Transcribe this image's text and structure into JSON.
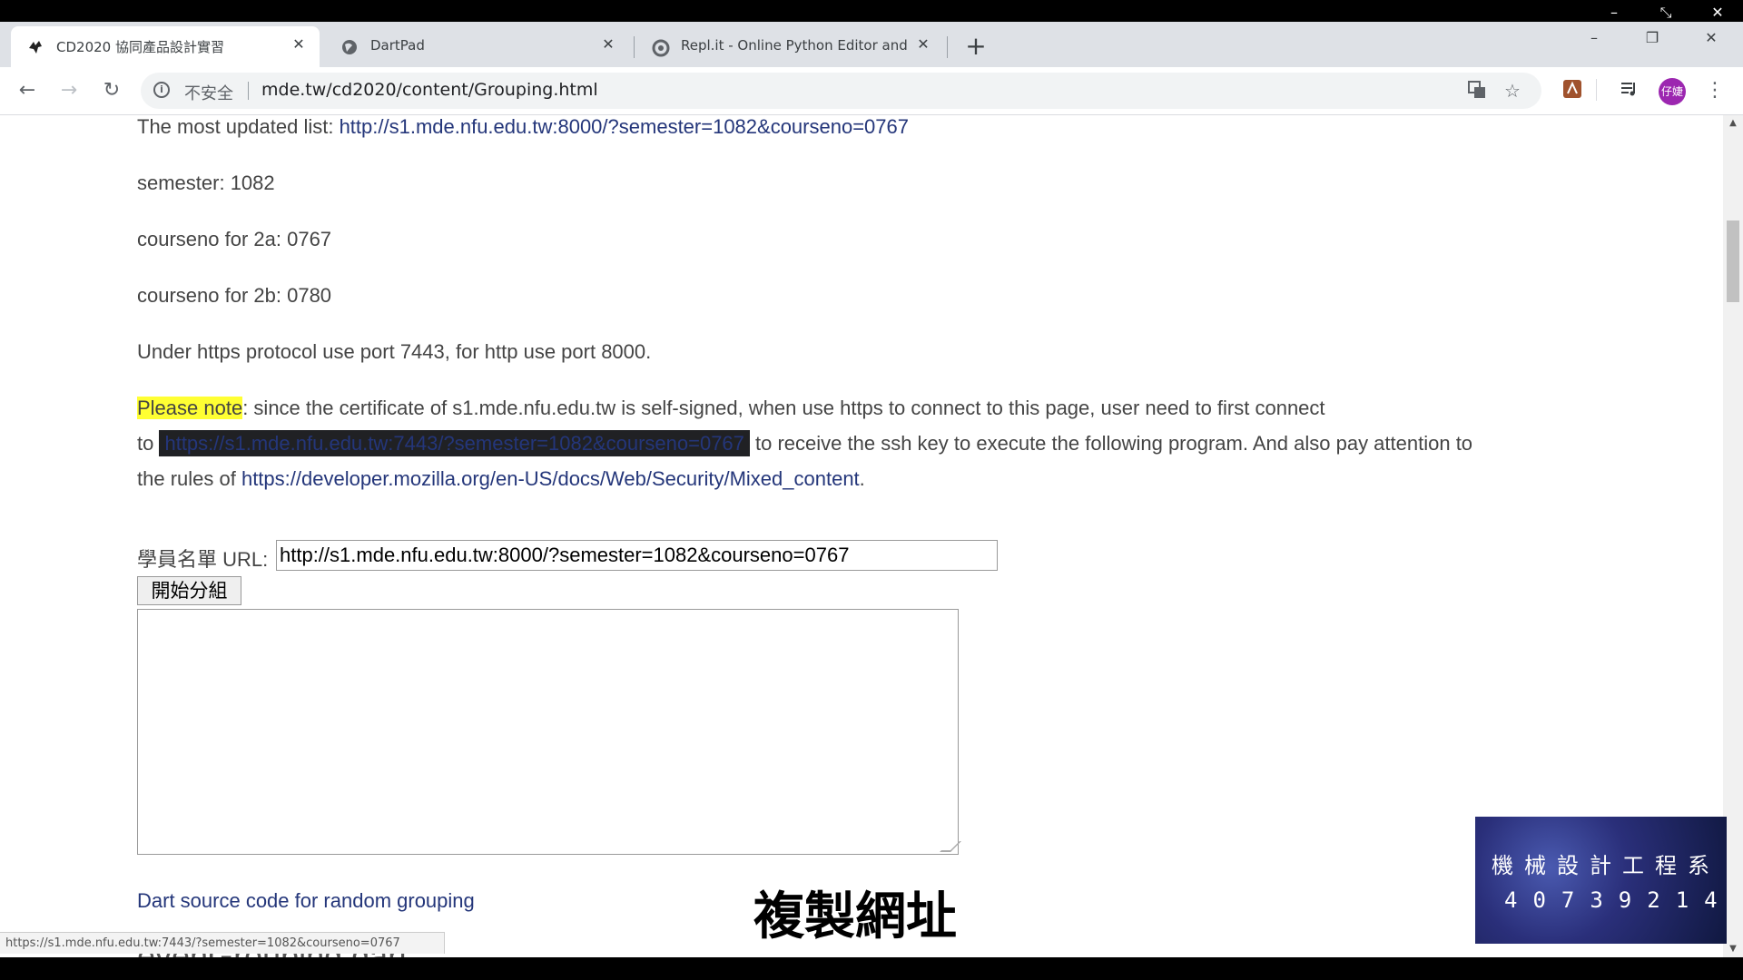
{
  "tabs": [
    {
      "title": "CD2020 協同產品設計實習",
      "close": "✕"
    },
    {
      "title": "DartPad",
      "close": "✕"
    },
    {
      "title": "Repl.it - Online Python Editor and IDE",
      "close": "✕"
    }
  ],
  "new_tab": "+",
  "omnibox": {
    "security_label": "不安全",
    "url": "mde.tw/cd2020/content/Grouping.html"
  },
  "avatar_text": "仔婕",
  "page": {
    "line1_prefix": "The most updated list: ",
    "line1_link": "http://s1.mde.nfu.edu.tw:8000/?semester=1082&courseno=0767",
    "semester": "semester: 1082",
    "courseno_2a": "courseno for 2a:  0767",
    "courseno_2b": "courseno for 2b: 0780",
    "protocol_note": "Under https protocol use port 7443, for http use port 8000.",
    "note_highlight": "Please note",
    "note_text1": ": since the certificate of s1.mde.nfu.edu.tw is self-signed, when use https to connect to this page, user need to first connect",
    "note_to": "to ",
    "note_link": "https://s1.mde.nfu.edu.tw:7443/?semester=1082&courseno=0767",
    "note_text2": " to receive the ssh key to execute the following program. And also pay attention to",
    "note_text3_prefix": "the rules of ",
    "note_link2": "https://developer.mozilla.org/en-US/docs/Web/Security/Mixed_content",
    "note_text3_suffix": ".",
    "url_label": "學員名單 URL: ",
    "url_value": "http://s1.mde.nfu.edu.tw:8000/?semester=1082&courseno=0767",
    "start_button": "開始分組",
    "dart_link": "Dart source code for random grouping",
    "heading": "evenGrouping.dart:"
  },
  "status_bar": "https://s1.mde.nfu.edu.tw:7443/?semester=1082&courseno=0767",
  "overlay": {
    "dept": "機械設計工程系",
    "student_id": "40739214",
    "subtitle": "複製網址"
  }
}
